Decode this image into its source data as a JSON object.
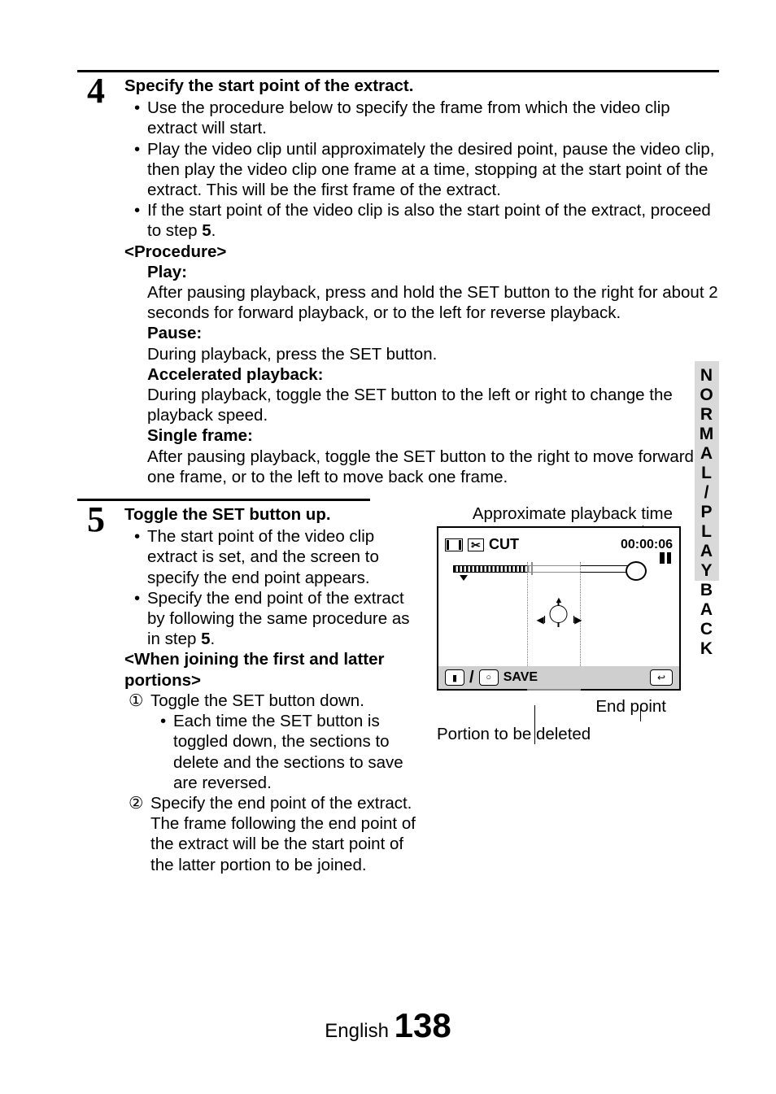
{
  "sidebar": {
    "label": "NORMAL/PLAYBACK"
  },
  "step4": {
    "num": "4",
    "title": "Specify the start point of the extract.",
    "b1": "Use the procedure below to specify the frame from which the video clip extract will start.",
    "b2a": "Play the video clip until approximately the desired point, pause the video clip, then play the video clip one frame at a time, stopping at the start point of the extract. This will be the first frame of the extract.",
    "b3a": "If the start point of the video clip is also the start point of the extract, proceed to step ",
    "b3bold": "5",
    "b3b": ".",
    "proc_hdr": "<Procedure>",
    "play_h": "Play:",
    "play_t": "After pausing playback, press and hold the SET button to the right for about 2 seconds for forward playback, or to the left for reverse playback.",
    "pause_h": "Pause:",
    "pause_t": "During playback, press the SET button.",
    "acc_h": "Accelerated playback:",
    "acc_t": "During playback, toggle the SET button to the left or right to change the playback speed.",
    "frame_h": "Single frame:",
    "frame_t": "After pausing playback, toggle the SET button to the right to move forward one frame, or to the left to move back one frame."
  },
  "step5": {
    "num": "5",
    "title": "Toggle the SET button up.",
    "b1": "The start point of the video clip extract is set, and the screen to specify the end point appears.",
    "b2a": "Specify the end point of the extract by following the same procedure as in step ",
    "b2bold": "5",
    "b2b": ".",
    "join_hdr": "<When joining the first and latter portions>",
    "e1": "Toggle the SET button down.",
    "e1sub": "Each time the SET button is toggled down, the sections to delete and the sections to save are reversed.",
    "e2": "Specify the end point of the extract. The frame following the end point of the extract will be the start point of the latter portion to be joined."
  },
  "diagram": {
    "approx": "Approximate playback time",
    "cut": "CUT",
    "time": "00:00:06",
    "save": "SAVE",
    "endpoint": "End point",
    "portion": "Portion to be deleted"
  },
  "footer": {
    "lang": "English ",
    "page": "138"
  }
}
